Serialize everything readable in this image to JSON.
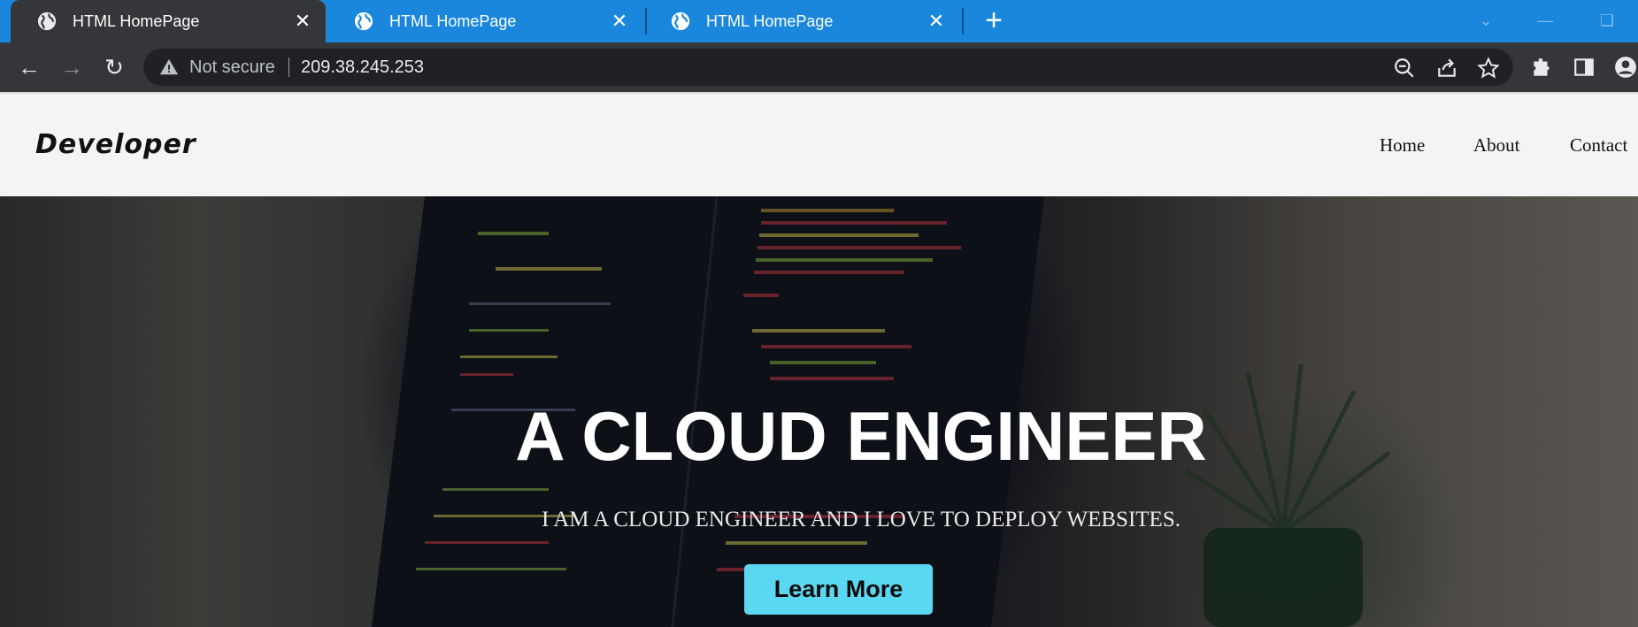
{
  "browser": {
    "tabs": [
      {
        "title": "HTML HomePage",
        "active": true
      },
      {
        "title": "HTML HomePage",
        "active": false
      },
      {
        "title": "HTML HomePage",
        "active": false
      }
    ],
    "new_tab_glyph": "+",
    "close_glyph": "✕",
    "address_bar": {
      "security_label": "Not secure",
      "url": "209.38.245.253"
    },
    "icons": [
      "back-arrow-icon",
      "forward-arrow-icon",
      "reload-icon",
      "warning-icon",
      "zoom-out-icon",
      "share-icon",
      "bookmark-star-icon",
      "extensions-icon",
      "side-panel-icon",
      "profile-icon"
    ],
    "colors": {
      "tabstrip": "#1a87dd",
      "toolbar": "#35363a",
      "omnibox": "#202124"
    }
  },
  "site": {
    "logo": "Developer",
    "nav": [
      "Home",
      "About",
      "Contact"
    ],
    "hero": {
      "title": "A CLOUD ENGINEER",
      "subtitle": "I AM A CLOUD ENGINEER AND I LOVE TO DEPLOY WEBSITES.",
      "button_label": "Learn More"
    },
    "colors": {
      "header_bg": "#f4f4f4",
      "button_bg": "#5bd8f1"
    }
  }
}
